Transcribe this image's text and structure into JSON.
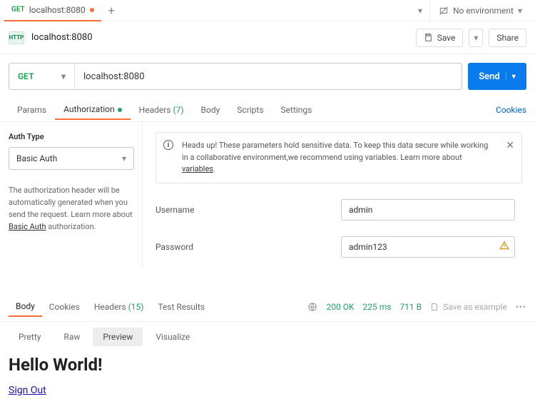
{
  "tab": {
    "method": "GET",
    "title": "localhost:8080",
    "dirty": true
  },
  "env": {
    "label": "No environment"
  },
  "request": {
    "title": "localhost:8080",
    "save_label": "Save",
    "share_label": "Share",
    "method": "GET",
    "url": "localhost:8080",
    "send_label": "Send"
  },
  "reqtabs": {
    "params": "Params",
    "authorization": "Authorization",
    "headers": "Headers",
    "headers_count": "(7)",
    "body": "Body",
    "scripts": "Scripts",
    "settings": "Settings",
    "cookies": "Cookies"
  },
  "auth": {
    "type_label": "Auth Type",
    "type_value": "Basic Auth",
    "desc_pre": "The authorization header will be automatically generated when you send the request. Learn more about ",
    "desc_link": "Basic Auth",
    "desc_post": " authorization.",
    "alert_pre": "Heads up! These parameters hold sensitive data. To keep this data secure while working in a collaborative environment,we recommend using variables. Learn more about ",
    "alert_link": "variables",
    "alert_post": ".",
    "username_label": "Username",
    "username_value": "admin",
    "password_label": "Password",
    "password_value": "admin123"
  },
  "resp": {
    "tabs": {
      "body": "Body",
      "cookies": "Cookies",
      "headers": "Headers",
      "headers_count": "(15)",
      "tests": "Test Results"
    },
    "status": "200 OK",
    "time": "225 ms",
    "size": "711 B",
    "save_example": "Save as example",
    "view": {
      "pretty": "Pretty",
      "raw": "Raw",
      "preview": "Preview",
      "visualize": "Visualize"
    }
  },
  "preview": {
    "heading": "Hello World!",
    "link": "Sign Out"
  }
}
